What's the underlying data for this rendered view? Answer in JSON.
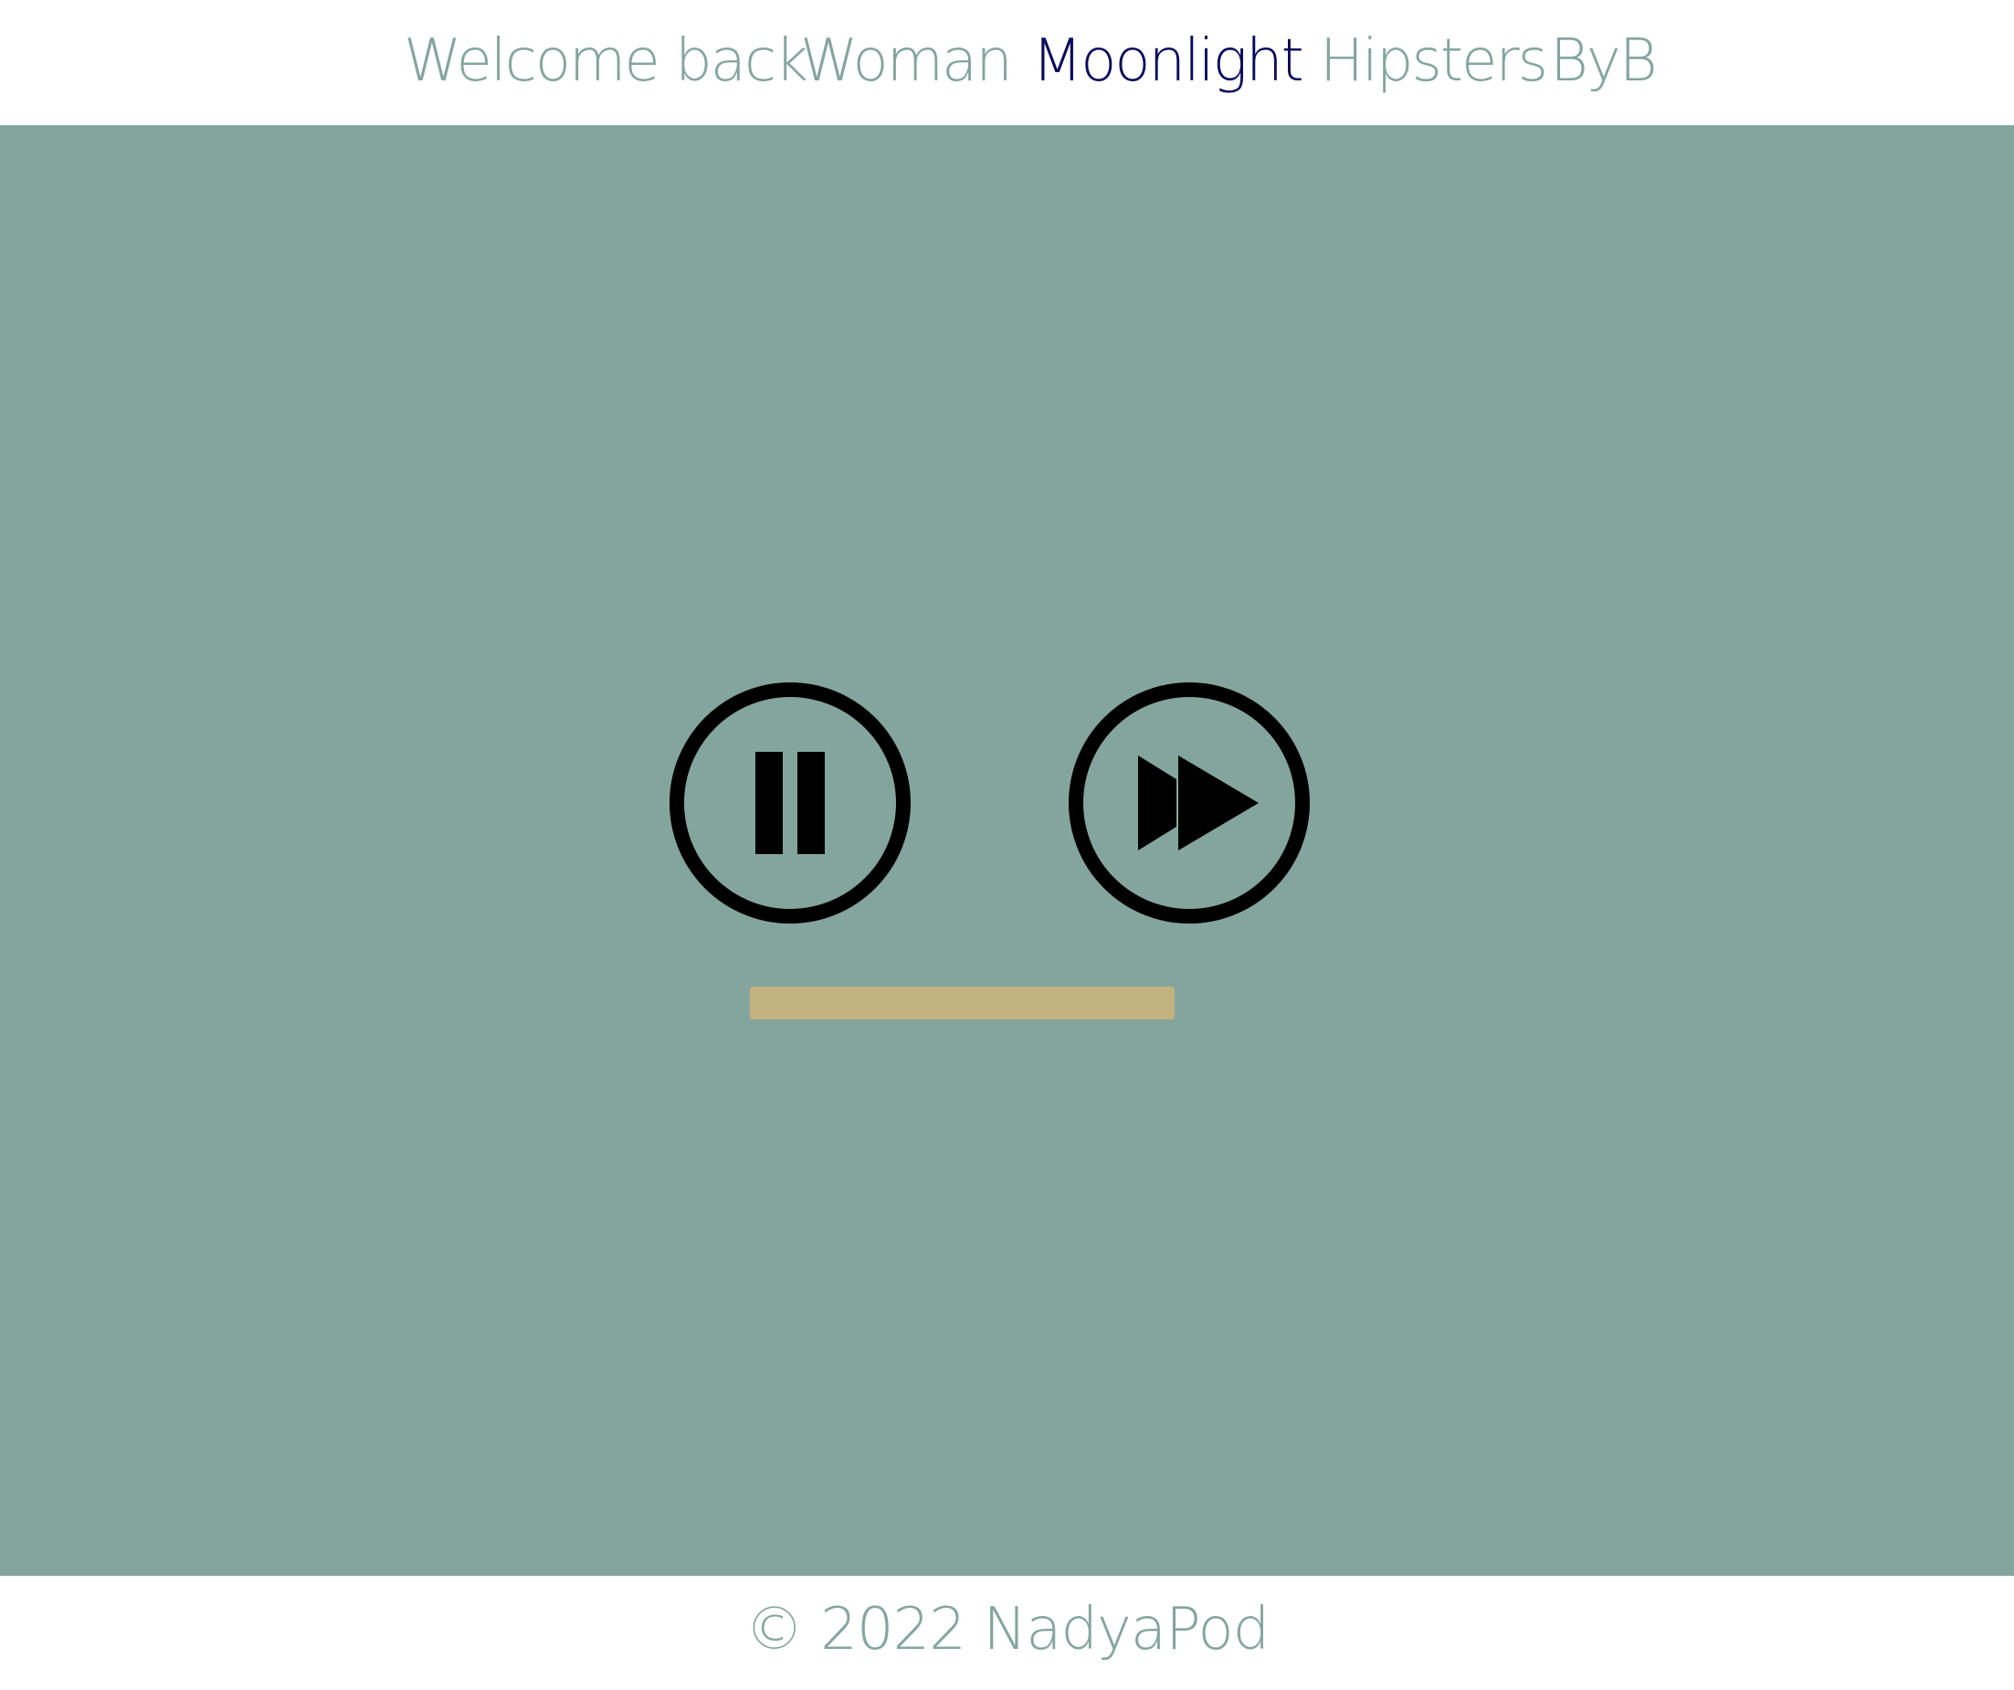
{
  "nav": {
    "items": [
      {
        "label": "Welcome back",
        "active": false
      },
      {
        "label": "Woman",
        "active": false
      },
      {
        "label": "Moonlight",
        "active": true
      },
      {
        "label": "Hipsters",
        "active": false
      },
      {
        "label": "ByB",
        "active": false
      }
    ]
  },
  "player": {
    "controls": [
      {
        "icon": "pause-icon"
      },
      {
        "icon": "fast-forward-icon"
      }
    ],
    "progress_fraction": 1.0
  },
  "footer": {
    "text": "© 2022 NadyaPod"
  },
  "colors": {
    "accent": "#84a59d",
    "active_nav": "#0b0a5c",
    "progress": "#c2b280",
    "icon": "#000000",
    "background": "#ffffff"
  }
}
